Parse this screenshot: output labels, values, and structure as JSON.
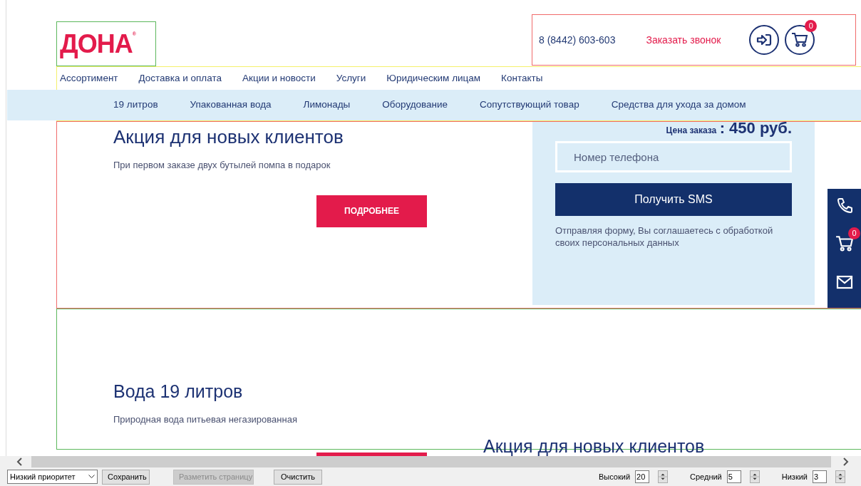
{
  "logo": {
    "text": "ДОНА",
    "mark": "®"
  },
  "header": {
    "phone": "8 (8442) 603-603",
    "callback": "Заказать звонок",
    "cart_count": "0"
  },
  "main_nav": {
    "items": [
      "Ассортимент",
      "Доставка и оплата",
      "Акции и новости",
      "Услуги",
      "Юридическим лицам",
      "Контакты"
    ]
  },
  "categories": [
    "19 литров",
    "Упакованная вода",
    "Лимонады",
    "Оборудование",
    "Сопутствующий товар",
    "Средства для ухода за домом"
  ],
  "promo": {
    "title": "Акция для новых клиентов",
    "subtitle": "При первом заказе двух бутылей помпа в подарок",
    "button": "ПОДРОБНЕЕ",
    "price_label": "Цена заказа",
    "price": ": 450 руб.",
    "phone_placeholder": "Номер телефона",
    "sms_button": "Получить SMS",
    "consent": "Отправляя форму, Вы соглашаетесь с обработкой своих персональных данных"
  },
  "side_panel": {
    "cart_count": "0"
  },
  "water": {
    "title": "Вода 19 литров",
    "subtitle": "Природная вода питьевая негазированная",
    "next_title": "Акция для новых клиентов"
  },
  "toolbar": {
    "priority": "Низкий приоритет",
    "buttons": [
      {
        "label": "Сохранить",
        "disabled": false
      },
      {
        "label": "Разметить страницу",
        "disabled": true
      },
      {
        "label": "Очистить",
        "disabled": false
      }
    ],
    "counters": [
      {
        "label": "Высокий",
        "value": "20"
      },
      {
        "label": "Средний",
        "value": "5"
      },
      {
        "label": "Низкий",
        "value": "3"
      }
    ]
  }
}
